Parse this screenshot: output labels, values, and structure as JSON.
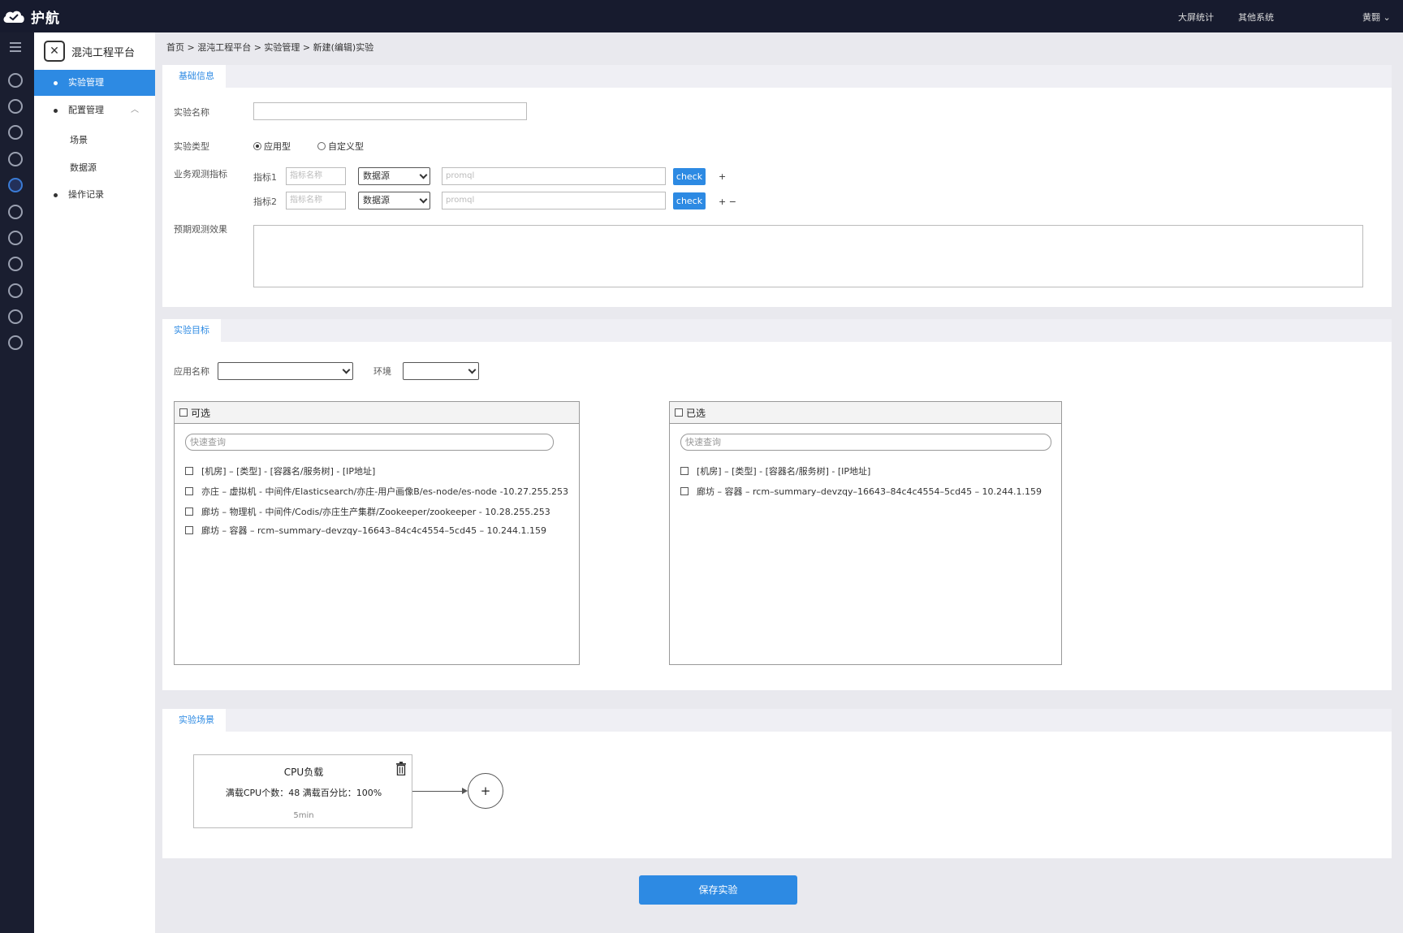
{
  "app": {
    "brand": "护航"
  },
  "topnav": {
    "item1": "大屏统计",
    "item2": "其他系统",
    "user": "黄翾"
  },
  "sidemenu": {
    "title": "混沌工程平台",
    "items": [
      "实验管理",
      "配置管理",
      "操作记录"
    ],
    "subitems": [
      "场景",
      "数据源"
    ]
  },
  "breadcrumb": "首页 > 混沌工程平台 > 实验管理 > 新建(编辑)实验",
  "basic": {
    "tab": "基础信息",
    "name_label": "实验名称",
    "name_value": "",
    "type_label": "实验类型",
    "type_options": [
      "应用型",
      "自定义型"
    ],
    "metrics_label": "业务观测指标",
    "metrics": [
      {
        "label": "指标1",
        "name_placeholder": "指标名称",
        "source": "数据源",
        "query_placeholder": "promql",
        "check": "check",
        "ops": "+"
      },
      {
        "label": "指标2",
        "name_placeholder": "指标名称",
        "source": "数据源",
        "query_placeholder": "promql",
        "check": "check",
        "ops": "+ −"
      }
    ],
    "expect_label": "预期观测效果"
  },
  "target": {
    "tab": "实验目标",
    "app_label": "应用名称",
    "env_label": "环境",
    "available": {
      "title": "可选",
      "search_placeholder": "快速查询",
      "items": [
        "[机房] – [类型] - [容器名/服务树] - [IP地址]",
        "亦庄 – 虚拟机 - 中间件/Elasticsearch/亦庄-用户画像B/es-node/es-node -10.27.255.253",
        "廊坊 – 物理机 - 中间件/Codis/亦庄生产集群/Zookeeper/zookeeper - 10.28.255.253",
        "廊坊 – 容器 – rcm–summary–devzqy–16643–84c4c4554–5cd45 – 10.244.1.159"
      ]
    },
    "selected": {
      "title": "已选",
      "search_placeholder": "快速查询",
      "items": [
        "[机房] – [类型] - [容器名/服务树] - [IP地址]",
        "廊坊 – 容器 – rcm–summary–devzqy–16643–84c4c4554–5cd45 – 10.244.1.159"
      ]
    },
    "move_right": ">",
    "move_left": "<"
  },
  "scene": {
    "tab": "实验场景",
    "card_title": "CPU负载",
    "card_desc": "满载CPU个数：48  满载百分比：100%",
    "card_duration": "5min",
    "add": "+"
  },
  "save_label": "保存实验",
  "colors": {
    "accent": "#2d8ae3",
    "topbar": "#171b2e",
    "rail": "#1a1e30"
  }
}
